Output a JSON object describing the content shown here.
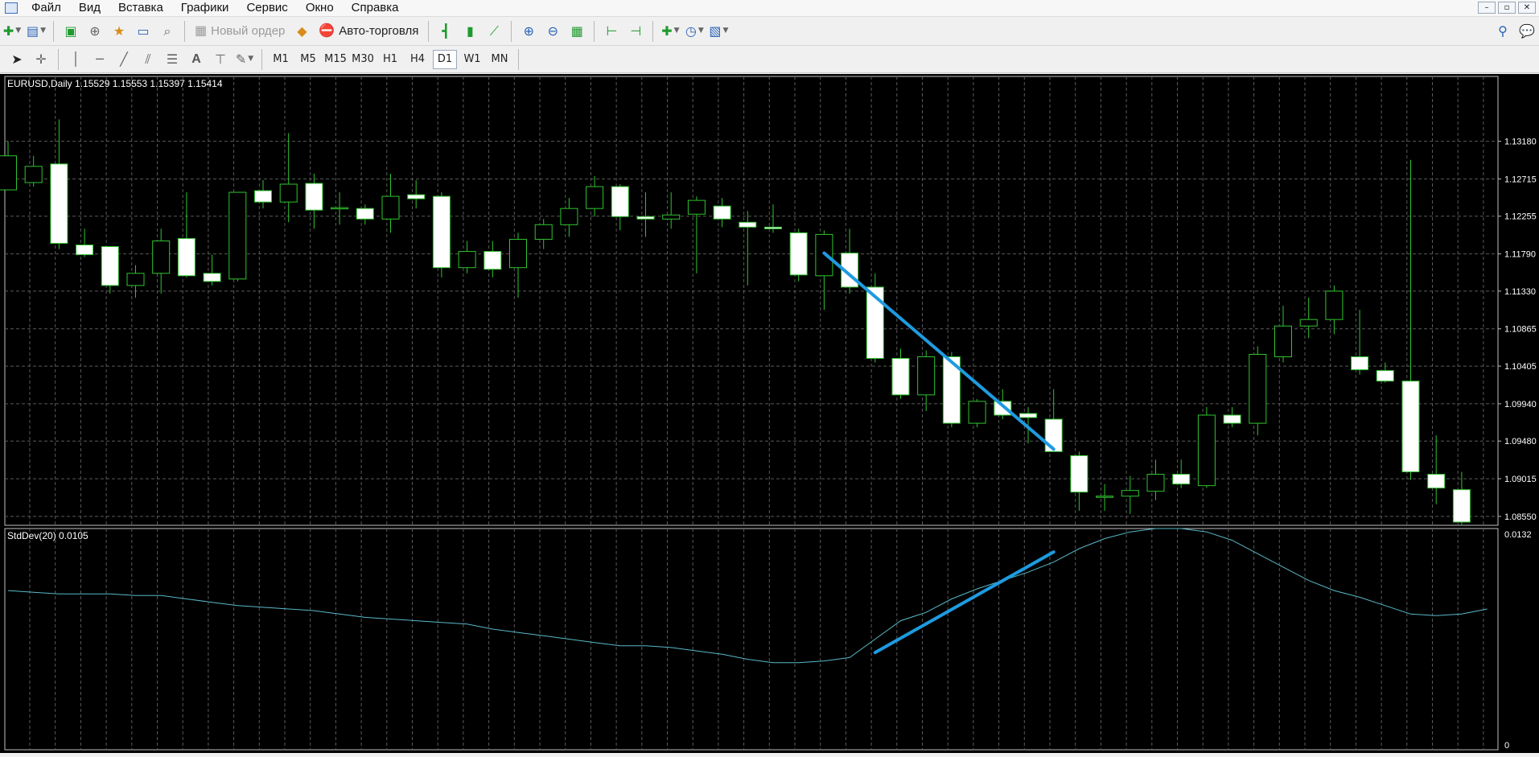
{
  "menu": {
    "items": [
      "Файл",
      "Вид",
      "Вставка",
      "Графики",
      "Сервис",
      "Окно",
      "Справка"
    ]
  },
  "window_controls": {
    "minimize": "–",
    "restore": "▫",
    "close": "✕"
  },
  "toolbar": {
    "new_order_label": "Новый ордер",
    "auto_trading_label": "Авто-торговля",
    "timeframes": [
      "M1",
      "M5",
      "M15",
      "M30",
      "H1",
      "H4",
      "D1",
      "W1",
      "MN"
    ],
    "active_timeframe": "D1"
  },
  "colors": {
    "chart_bg": "#000000",
    "grid": "#5a5a5a",
    "candle_bull_body": "#000000",
    "candle_bear_body": "#ffffff",
    "candle_outline": "#2fc42f",
    "stddev_line": "#58b8c8",
    "trend_line": "#1e9be0",
    "separator": "#bfbfbf",
    "text": "#ffffff"
  },
  "chart_data": [
    {
      "type": "candlestick",
      "header": "EURUSD,Daily  1.15529 1.15553 1.15397 1.15414",
      "price_axis_labels": [
        "1.13180",
        "1.12715",
        "1.12255",
        "1.11790",
        "1.11330",
        "1.10865",
        "1.10405",
        "1.09940",
        "1.09480",
        "1.09015",
        "1.08550"
      ],
      "ylim": [
        1.0844,
        1.1398
      ],
      "grid": true,
      "candles": [
        {
          "o": 1.1258,
          "h": 1.1318,
          "l": 1.1258,
          "c": 1.13
        },
        {
          "o": 1.1267,
          "h": 1.13,
          "l": 1.1262,
          "c": 1.1287
        },
        {
          "o": 1.129,
          "h": 1.1345,
          "l": 1.1185,
          "c": 1.1192
        },
        {
          "o": 1.119,
          "h": 1.121,
          "l": 1.1175,
          "c": 1.1178
        },
        {
          "o": 1.1188,
          "h": 1.1188,
          "l": 1.113,
          "c": 1.114
        },
        {
          "o": 1.114,
          "h": 1.1165,
          "l": 1.1125,
          "c": 1.1155
        },
        {
          "o": 1.1155,
          "h": 1.121,
          "l": 1.113,
          "c": 1.1195
        },
        {
          "o": 1.1198,
          "h": 1.1255,
          "l": 1.115,
          "c": 1.1152
        },
        {
          "o": 1.1155,
          "h": 1.1178,
          "l": 1.114,
          "c": 1.1145
        },
        {
          "o": 1.1148,
          "h": 1.1255,
          "l": 1.1145,
          "c": 1.1255
        },
        {
          "o": 1.1257,
          "h": 1.127,
          "l": 1.1235,
          "c": 1.1243
        },
        {
          "o": 1.1243,
          "h": 1.1328,
          "l": 1.1218,
          "c": 1.1265
        },
        {
          "o": 1.1266,
          "h": 1.1278,
          "l": 1.121,
          "c": 1.1233
        },
        {
          "o": 1.1235,
          "h": 1.1255,
          "l": 1.1215,
          "c": 1.1236
        },
        {
          "o": 1.1235,
          "h": 1.124,
          "l": 1.1215,
          "c": 1.1222
        },
        {
          "o": 1.1222,
          "h": 1.1278,
          "l": 1.1205,
          "c": 1.125
        },
        {
          "o": 1.1252,
          "h": 1.127,
          "l": 1.1235,
          "c": 1.1247
        },
        {
          "o": 1.125,
          "h": 1.1255,
          "l": 1.115,
          "c": 1.1162
        },
        {
          "o": 1.1162,
          "h": 1.1195,
          "l": 1.1155,
          "c": 1.1182
        },
        {
          "o": 1.1182,
          "h": 1.1195,
          "l": 1.115,
          "c": 1.116
        },
        {
          "o": 1.1162,
          "h": 1.1205,
          "l": 1.1125,
          "c": 1.1197
        },
        {
          "o": 1.1197,
          "h": 1.1222,
          "l": 1.1185,
          "c": 1.1215
        },
        {
          "o": 1.1215,
          "h": 1.1248,
          "l": 1.12,
          "c": 1.1235
        },
        {
          "o": 1.1235,
          "h": 1.1275,
          "l": 1.1225,
          "c": 1.1262
        },
        {
          "o": 1.1262,
          "h": 1.1265,
          "l": 1.1208,
          "c": 1.1225
        },
        {
          "o": 1.1225,
          "h": 1.1255,
          "l": 1.12,
          "c": 1.1222
        },
        {
          "o": 1.1222,
          "h": 1.1255,
          "l": 1.121,
          "c": 1.1227
        },
        {
          "o": 1.1228,
          "h": 1.125,
          "l": 1.1155,
          "c": 1.1245
        },
        {
          "o": 1.1238,
          "h": 1.1248,
          "l": 1.1212,
          "c": 1.1222
        },
        {
          "o": 1.1218,
          "h": 1.1232,
          "l": 1.114,
          "c": 1.1212
        },
        {
          "o": 1.1212,
          "h": 1.124,
          "l": 1.1205,
          "c": 1.121
        },
        {
          "o": 1.1205,
          "h": 1.121,
          "l": 1.1145,
          "c": 1.1153
        },
        {
          "o": 1.1152,
          "h": 1.1208,
          "l": 1.111,
          "c": 1.1203
        },
        {
          "o": 1.118,
          "h": 1.121,
          "l": 1.113,
          "c": 1.1138
        },
        {
          "o": 1.1138,
          "h": 1.1155,
          "l": 1.1045,
          "c": 1.105
        },
        {
          "o": 1.105,
          "h": 1.1062,
          "l": 1.1,
          "c": 1.1005
        },
        {
          "o": 1.1005,
          "h": 1.106,
          "l": 1.0985,
          "c": 1.1052
        },
        {
          "o": 1.1052,
          "h": 1.1058,
          "l": 1.0965,
          "c": 1.097
        },
        {
          "o": 1.097,
          "h": 1.1,
          "l": 1.0965,
          "c": 1.0997
        },
        {
          "o": 1.0997,
          "h": 1.1012,
          "l": 1.0975,
          "c": 1.098
        },
        {
          "o": 1.0982,
          "h": 1.099,
          "l": 1.0945,
          "c": 1.0977
        },
        {
          "o": 1.0975,
          "h": 1.1012,
          "l": 1.0935,
          "c": 1.0935
        },
        {
          "o": 1.093,
          "h": 1.0935,
          "l": 1.0862,
          "c": 1.0885
        },
        {
          "o": 1.088,
          "h": 1.0895,
          "l": 1.0862,
          "c": 1.088
        },
        {
          "o": 1.088,
          "h": 1.0905,
          "l": 1.0858,
          "c": 1.0887
        },
        {
          "o": 1.0886,
          "h": 1.0925,
          "l": 1.0875,
          "c": 1.0907
        },
        {
          "o": 1.0907,
          "h": 1.0925,
          "l": 1.089,
          "c": 1.0895
        },
        {
          "o": 1.0893,
          "h": 1.099,
          "l": 1.089,
          "c": 1.098
        },
        {
          "o": 1.098,
          "h": 1.099,
          "l": 1.0965,
          "c": 1.097
        },
        {
          "o": 1.097,
          "h": 1.1065,
          "l": 1.0955,
          "c": 1.1055
        },
        {
          "o": 1.1052,
          "h": 1.1115,
          "l": 1.1045,
          "c": 1.109
        },
        {
          "o": 1.109,
          "h": 1.1125,
          "l": 1.1075,
          "c": 1.1098
        },
        {
          "o": 1.1098,
          "h": 1.114,
          "l": 1.108,
          "c": 1.1133
        },
        {
          "o": 1.1052,
          "h": 1.111,
          "l": 1.103,
          "c": 1.1036
        },
        {
          "o": 1.1035,
          "h": 1.1045,
          "l": 1.102,
          "c": 1.1022
        },
        {
          "o": 1.1022,
          "h": 1.1295,
          "l": 1.09,
          "c": 1.091
        },
        {
          "o": 1.0907,
          "h": 1.0955,
          "l": 1.087,
          "c": 1.089
        },
        {
          "o": 1.0888,
          "h": 1.091,
          "l": 1.0845,
          "c": 1.0848
        }
      ]
    },
    {
      "type": "line",
      "header": "StdDev(20) 0.0105",
      "axis_labels": [
        "0.0132",
        "0"
      ],
      "ylim": [
        0,
        0.0132
      ],
      "values": [
        0.0095,
        0.0094,
        0.0093,
        0.0093,
        0.0093,
        0.0092,
        0.0092,
        0.009,
        0.0088,
        0.0086,
        0.0085,
        0.0084,
        0.0083,
        0.0081,
        0.0079,
        0.0078,
        0.0077,
        0.0076,
        0.0075,
        0.0072,
        0.007,
        0.0068,
        0.0066,
        0.0064,
        0.0062,
        0.0062,
        0.0061,
        0.0059,
        0.0057,
        0.0054,
        0.0052,
        0.0052,
        0.0053,
        0.0055,
        0.0066,
        0.0077,
        0.0082,
        0.009,
        0.0096,
        0.0101,
        0.0106,
        0.0112,
        0.012,
        0.0126,
        0.013,
        0.0132,
        0.0132,
        0.013,
        0.0125,
        0.0117,
        0.0109,
        0.0101,
        0.0095,
        0.0091,
        0.0086,
        0.0081,
        0.008,
        0.0081,
        0.0084
      ]
    }
  ],
  "annotations": {
    "price_trend_line": {
      "from_candle": 32,
      "from_price": 1.118,
      "to_candle": 41,
      "to_price": 1.0938
    },
    "stddev_trend_line": {
      "from_candle": 34,
      "from_value": 0.0058,
      "to_candle": 41,
      "to_value": 0.0118
    }
  }
}
